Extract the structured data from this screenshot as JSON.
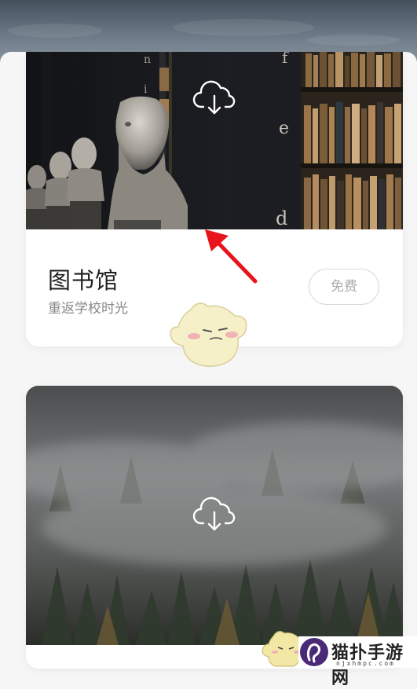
{
  "cards": [
    {
      "title": "图书馆",
      "subtitle": "重返学校时光",
      "badge": "免费",
      "image": "library-busts-bookshelf-photo",
      "icon": "cloud-download-icon"
    },
    {
      "image": "misty-forest-photo",
      "icon": "cloud-download-icon"
    }
  ],
  "annotation": {
    "arrow_color": "#e8141b"
  },
  "watermark": {
    "text": "猫扑手游网",
    "url": "njxhmpc.com",
    "logo_color": "#4a2a76"
  },
  "colors": {
    "background": "#f6f6f6",
    "card": "#ffffff",
    "title": "#1f1f1f",
    "subtitle": "#888888"
  }
}
